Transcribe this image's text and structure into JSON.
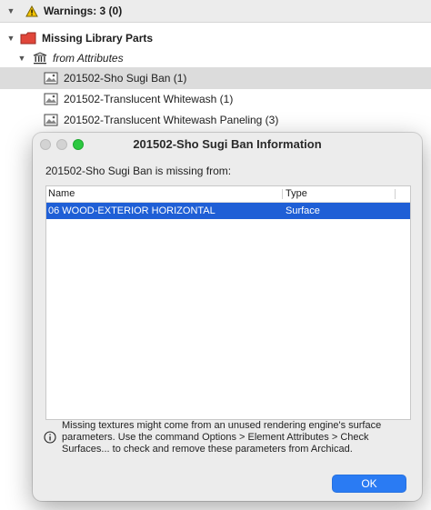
{
  "tree": {
    "header_label": "Warnings: 3 (0)",
    "group_label": "Missing Library Parts",
    "subgroup_label": "from Attributes",
    "items": [
      {
        "label": "201502-Sho Sugi Ban (1)"
      },
      {
        "label": "201502-Translucent Whitewash (1)"
      },
      {
        "label": "201502-Translucent Whitewash Paneling (3)"
      }
    ]
  },
  "dialog": {
    "title": "201502-Sho Sugi Ban Information",
    "subtitle": "201502-Sho Sugi Ban is missing from:",
    "columns": {
      "name": "Name",
      "type": "Type"
    },
    "rows": [
      {
        "name": "06 WOOD-EXTERIOR HORIZONTAL",
        "type": "Surface"
      }
    ],
    "info_text": "Missing textures might come from an unused rendering engine's surface parameters. Use the command Options > Element Attributes > Check Surfaces... to check and remove these parameters from Archicad.",
    "ok_label": "OK"
  },
  "colors": {
    "selection": "#1f5fd6",
    "ok_button": "#2a7bf3",
    "folder_red": "#e0463a",
    "warning_yellow": "#f5c400"
  },
  "icons": [
    "disclosure-icon",
    "warning-icon",
    "folder-icon",
    "library-icon",
    "texture-icon",
    "info-icon"
  ]
}
